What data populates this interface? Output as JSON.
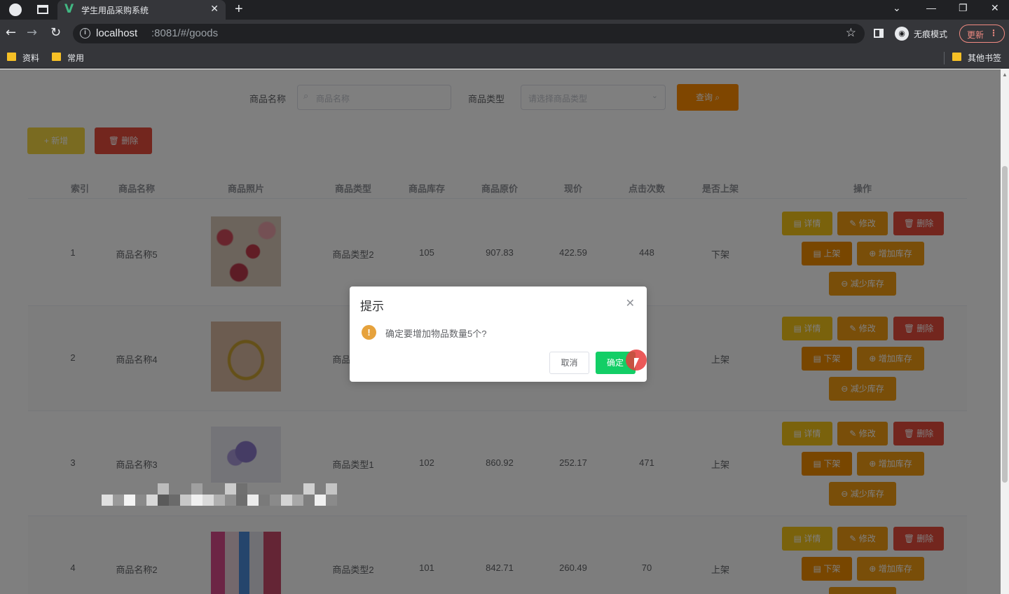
{
  "browser": {
    "tab_title": "学生用品采购系统",
    "url_host": "localhost",
    "url_path": ":8081/#/goods",
    "incognito_label": "无痕模式",
    "update_label": "更新",
    "bookmarks": [
      "资料",
      "常用"
    ],
    "other_bookmarks": "其他书签"
  },
  "search": {
    "name_label": "商品名称",
    "name_placeholder": "商品名称",
    "type_label": "商品类型",
    "type_placeholder": "请选择商品类型",
    "query_label": "查询"
  },
  "actions": {
    "add_label": "+ 新增",
    "delete_label": "删除"
  },
  "table": {
    "headers": [
      "索引",
      "商品名称",
      "商品照片",
      "商品类型",
      "商品库存",
      "商品原价",
      "现价",
      "点击次数",
      "是否上架",
      "操作"
    ],
    "rows": [
      {
        "index": "1",
        "name": "商品名称5",
        "type": "商品类型2",
        "stock": "105",
        "orig_price": "907.83",
        "price": "422.59",
        "clicks": "448",
        "shelf": "下架",
        "shelf_btn": "上架"
      },
      {
        "index": "2",
        "name": "商品名称4",
        "type": "商品类型2",
        "stock": "",
        "orig_price": "",
        "price": "",
        "clicks": "",
        "shelf": "上架",
        "shelf_btn": "下架"
      },
      {
        "index": "3",
        "name": "商品名称3",
        "type": "商品类型1",
        "stock": "102",
        "orig_price": "860.92",
        "price": "252.17",
        "clicks": "471",
        "shelf": "上架",
        "shelf_btn": "下架"
      },
      {
        "index": "4",
        "name": "商品名称2",
        "type": "商品类型2",
        "stock": "101",
        "orig_price": "842.71",
        "price": "260.49",
        "clicks": "70",
        "shelf": "上架",
        "shelf_btn": "下架"
      }
    ],
    "row_buttons": {
      "detail": "详情",
      "edit": "修改",
      "remove": "删除",
      "increase": "增加库存",
      "decrease": "减少库存"
    }
  },
  "dialog": {
    "title": "提示",
    "message": "确定要增加物品数量5个?",
    "cancel": "取消",
    "confirm": "确定"
  }
}
